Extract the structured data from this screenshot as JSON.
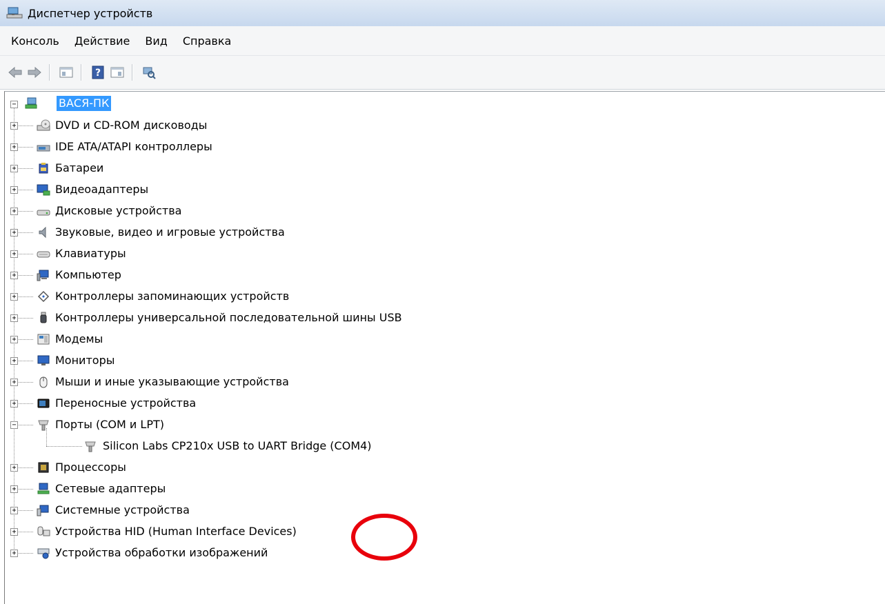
{
  "window": {
    "title": "Диспетчер устройств"
  },
  "menu": {
    "items": [
      "Консоль",
      "Действие",
      "Вид",
      "Справка"
    ]
  },
  "toolbar": {
    "buttons": [
      "back-arrow-icon",
      "forward-arrow-icon",
      "show-hide-tree-icon",
      "help-icon",
      "properties-icon",
      "scan-hardware-icon"
    ]
  },
  "tree": {
    "root": {
      "label": "ВАСЯ-ПК",
      "expanded": true,
      "selected": true,
      "icon": "computer-network-icon"
    },
    "categories": [
      {
        "label": "DVD и CD-ROM дисководы",
        "icon": "dvd-drive-icon",
        "expanded": false
      },
      {
        "label": "IDE ATA/ATAPI контроллеры",
        "icon": "ide-controller-icon",
        "expanded": false
      },
      {
        "label": "Батареи",
        "icon": "battery-icon",
        "expanded": false
      },
      {
        "label": "Видеоадаптеры",
        "icon": "display-adapter-icon",
        "expanded": false
      },
      {
        "label": "Дисковые устройства",
        "icon": "disk-drive-icon",
        "expanded": false
      },
      {
        "label": "Звуковые, видео и игровые устройства",
        "icon": "speaker-icon",
        "expanded": false
      },
      {
        "label": "Клавиатуры",
        "icon": "keyboard-icon",
        "expanded": false
      },
      {
        "label": "Компьютер",
        "icon": "computer-icon",
        "expanded": false
      },
      {
        "label": "Контроллеры запоминающих устройств",
        "icon": "storage-controller-icon",
        "expanded": false
      },
      {
        "label": "Контроллеры универсальной последовательной шины USB",
        "icon": "usb-icon",
        "expanded": false
      },
      {
        "label": "Модемы",
        "icon": "modem-icon",
        "expanded": false
      },
      {
        "label": "Мониторы",
        "icon": "monitor-icon",
        "expanded": false
      },
      {
        "label": "Мыши и иные указывающие устройства",
        "icon": "mouse-icon",
        "expanded": false
      },
      {
        "label": "Переносные устройства",
        "icon": "portable-device-icon",
        "expanded": false
      },
      {
        "label": "Порты (COM и LPT)",
        "icon": "port-icon",
        "expanded": true,
        "children": [
          {
            "label": "Silicon Labs CP210x USB to UART Bridge (COM4)",
            "icon": "port-icon"
          }
        ]
      },
      {
        "label": "Процессоры",
        "icon": "processor-icon",
        "expanded": false
      },
      {
        "label": "Сетевые адаптеры",
        "icon": "network-adapter-icon",
        "expanded": false
      },
      {
        "label": "Системные устройства",
        "icon": "system-device-icon",
        "expanded": false
      },
      {
        "label": "Устройства HID (Human Interface Devices)",
        "icon": "hid-icon",
        "expanded": false
      },
      {
        "label": "Устройства обработки изображений",
        "icon": "imaging-device-icon",
        "expanded": false
      }
    ]
  },
  "annotation": {
    "color": "#e8000b",
    "target": "(COM4)"
  },
  "colors": {
    "selection": "#3399ff",
    "titlebar": "#c7d8ee"
  }
}
